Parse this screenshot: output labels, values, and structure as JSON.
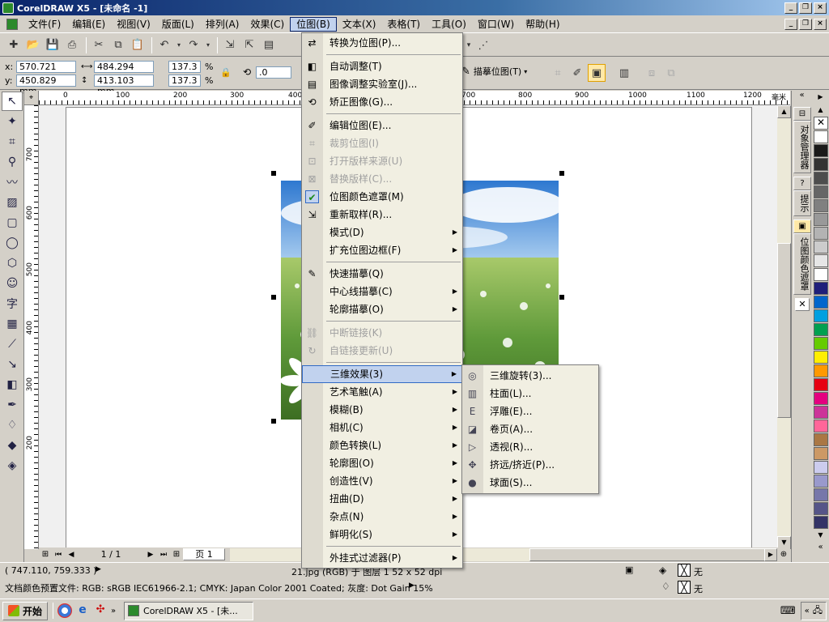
{
  "window": {
    "title": "CorelDRAW X5 - [未命名 -1]",
    "controls": [
      "_",
      "❐",
      "×"
    ]
  },
  "menubar": {
    "items": [
      "文件(F)",
      "编辑(E)",
      "视图(V)",
      "版面(L)",
      "排列(A)",
      "效果(C)",
      "位图(B)",
      "文本(X)",
      "表格(T)",
      "工具(O)",
      "窗口(W)",
      "帮助(H)"
    ],
    "active_index": 6
  },
  "toolbar": {
    "zoom_value": "",
    "trace_button": "描摹位图(T)"
  },
  "property_bar": {
    "x_label": "x:",
    "x_value": "570.721 mm",
    "y_label": "y:",
    "y_value": "450.829 mm",
    "w_value": "484.294 mm",
    "h_value": "413.103 mm",
    "scale_x": "137.3",
    "scale_y": "137.3",
    "pct": "%",
    "rotation": ".0"
  },
  "ruler": {
    "h_ticks": [
      "0",
      "100",
      "200",
      "300",
      "400",
      "700",
      "800",
      "900",
      "1000",
      "1100",
      "1200"
    ],
    "h_unit": "毫米",
    "v_ticks": [
      "700",
      "600",
      "500",
      "400",
      "300",
      "200"
    ]
  },
  "bitmap_menu": {
    "items": [
      {
        "label": "转换为位图(P)...",
        "icon": "convert-bitmap-icon",
        "enabled": true,
        "submenu": false
      },
      {
        "sep": true
      },
      {
        "label": "自动调整(T)",
        "icon": "auto-adjust-icon",
        "enabled": true,
        "submenu": false
      },
      {
        "label": "图像调整实验室(J)...",
        "icon": "image-lab-icon",
        "enabled": true,
        "submenu": false
      },
      {
        "label": "矫正图像(G)...",
        "icon": "straighten-icon",
        "enabled": true,
        "submenu": false
      },
      {
        "sep": true
      },
      {
        "label": "编辑位图(E)...",
        "icon": "edit-bitmap-icon",
        "enabled": true,
        "submenu": false
      },
      {
        "label": "裁剪位图(I)",
        "icon": "crop-bitmap-icon",
        "enabled": false,
        "submenu": false
      },
      {
        "label": "打开版样来源(U)",
        "icon": "open-source-icon",
        "enabled": false,
        "submenu": false
      },
      {
        "label": "替换版样(C)...",
        "icon": "replace-icon",
        "enabled": false,
        "submenu": false
      },
      {
        "label": "位图颜色遮罩(M)",
        "icon": "check-icon",
        "enabled": true,
        "submenu": false
      },
      {
        "label": "重新取样(R)...",
        "icon": "resample-icon",
        "enabled": true,
        "submenu": false
      },
      {
        "label": "模式(D)",
        "icon": "",
        "enabled": true,
        "submenu": true
      },
      {
        "label": "扩充位图边框(F)",
        "icon": "",
        "enabled": true,
        "submenu": true
      },
      {
        "sep": true
      },
      {
        "label": "快速描摹(Q)",
        "icon": "quick-trace-icon",
        "enabled": true,
        "submenu": false
      },
      {
        "label": "中心线描摹(C)",
        "icon": "",
        "enabled": true,
        "submenu": true
      },
      {
        "label": "轮廓描摹(O)",
        "icon": "",
        "enabled": true,
        "submenu": true
      },
      {
        "sep": true
      },
      {
        "label": "中断链接(K)",
        "icon": "break-link-icon",
        "enabled": false,
        "submenu": false
      },
      {
        "label": "自链接更新(U)",
        "icon": "update-link-icon",
        "enabled": false,
        "submenu": false
      },
      {
        "sep": true
      },
      {
        "label": "三维效果(3)",
        "icon": "",
        "enabled": true,
        "submenu": true,
        "highlighted": true
      },
      {
        "label": "艺术笔触(A)",
        "icon": "",
        "enabled": true,
        "submenu": true
      },
      {
        "label": "模糊(B)",
        "icon": "",
        "enabled": true,
        "submenu": true
      },
      {
        "label": "相机(C)",
        "icon": "",
        "enabled": true,
        "submenu": true
      },
      {
        "label": "颜色转换(L)",
        "icon": "",
        "enabled": true,
        "submenu": true
      },
      {
        "label": "轮廓图(O)",
        "icon": "",
        "enabled": true,
        "submenu": true
      },
      {
        "label": "创造性(V)",
        "icon": "",
        "enabled": true,
        "submenu": true
      },
      {
        "label": "扭曲(D)",
        "icon": "",
        "enabled": true,
        "submenu": true
      },
      {
        "label": "杂点(N)",
        "icon": "",
        "enabled": true,
        "submenu": true
      },
      {
        "label": "鲜明化(S)",
        "icon": "",
        "enabled": true,
        "submenu": true
      },
      {
        "sep": true
      },
      {
        "label": "外挂式过滤器(P)",
        "icon": "",
        "enabled": true,
        "submenu": true
      }
    ]
  },
  "effects_submenu": {
    "items": [
      {
        "label": "三维旋转(3)...",
        "icon": "3d-rotate-icon"
      },
      {
        "label": "柱面(L)...",
        "icon": "cylinder-icon"
      },
      {
        "label": "浮雕(E)...",
        "icon": "emboss-icon"
      },
      {
        "label": "卷页(A)...",
        "icon": "page-curl-icon"
      },
      {
        "label": "透视(R)...",
        "icon": "perspective-icon"
      },
      {
        "label": "挤远/挤近(P)...",
        "icon": "pinch-punch-icon"
      },
      {
        "label": "球面(S)...",
        "icon": "sphere-icon"
      }
    ]
  },
  "docker": {
    "tabs": [
      "对象管理器",
      "提示",
      "位图颜色遮罩"
    ]
  },
  "palette": {
    "colors": [
      "#ffffff",
      "#1a1a1a",
      "#333333",
      "#4d4d4d",
      "#666666",
      "#808080",
      "#999999",
      "#b3b3b3",
      "#cccccc",
      "#e6e6e6",
      "#ffffff",
      "#1f1f7a",
      "#0066cc",
      "#00a0e0",
      "#00a050",
      "#66cc00",
      "#ffee00",
      "#ff9900",
      "#e60012",
      "#e4007f",
      "#cc3399",
      "#ff6699",
      "#aa7744",
      "#cc9966",
      "#ccccee",
      "#9999cc",
      "#7777aa",
      "#555588",
      "#333366"
    ]
  },
  "page_nav": {
    "counter": "1 / 1",
    "tab": "页 1"
  },
  "status": {
    "coords": "( 747.110, 759.333 )",
    "object_info": "21.jpg (RGB) 于 图层 1 52 x 52 dpi",
    "fill_label": "无",
    "outline_label": "无",
    "color_profile": "文档颜色预置文件: RGB: sRGB IEC61966-2.1; CMYK: Japan Color 2001 Coated; 灰度: Dot Gain 15%"
  },
  "taskbar": {
    "start": "开始",
    "task": "CorelDRAW X5 - [未..."
  }
}
